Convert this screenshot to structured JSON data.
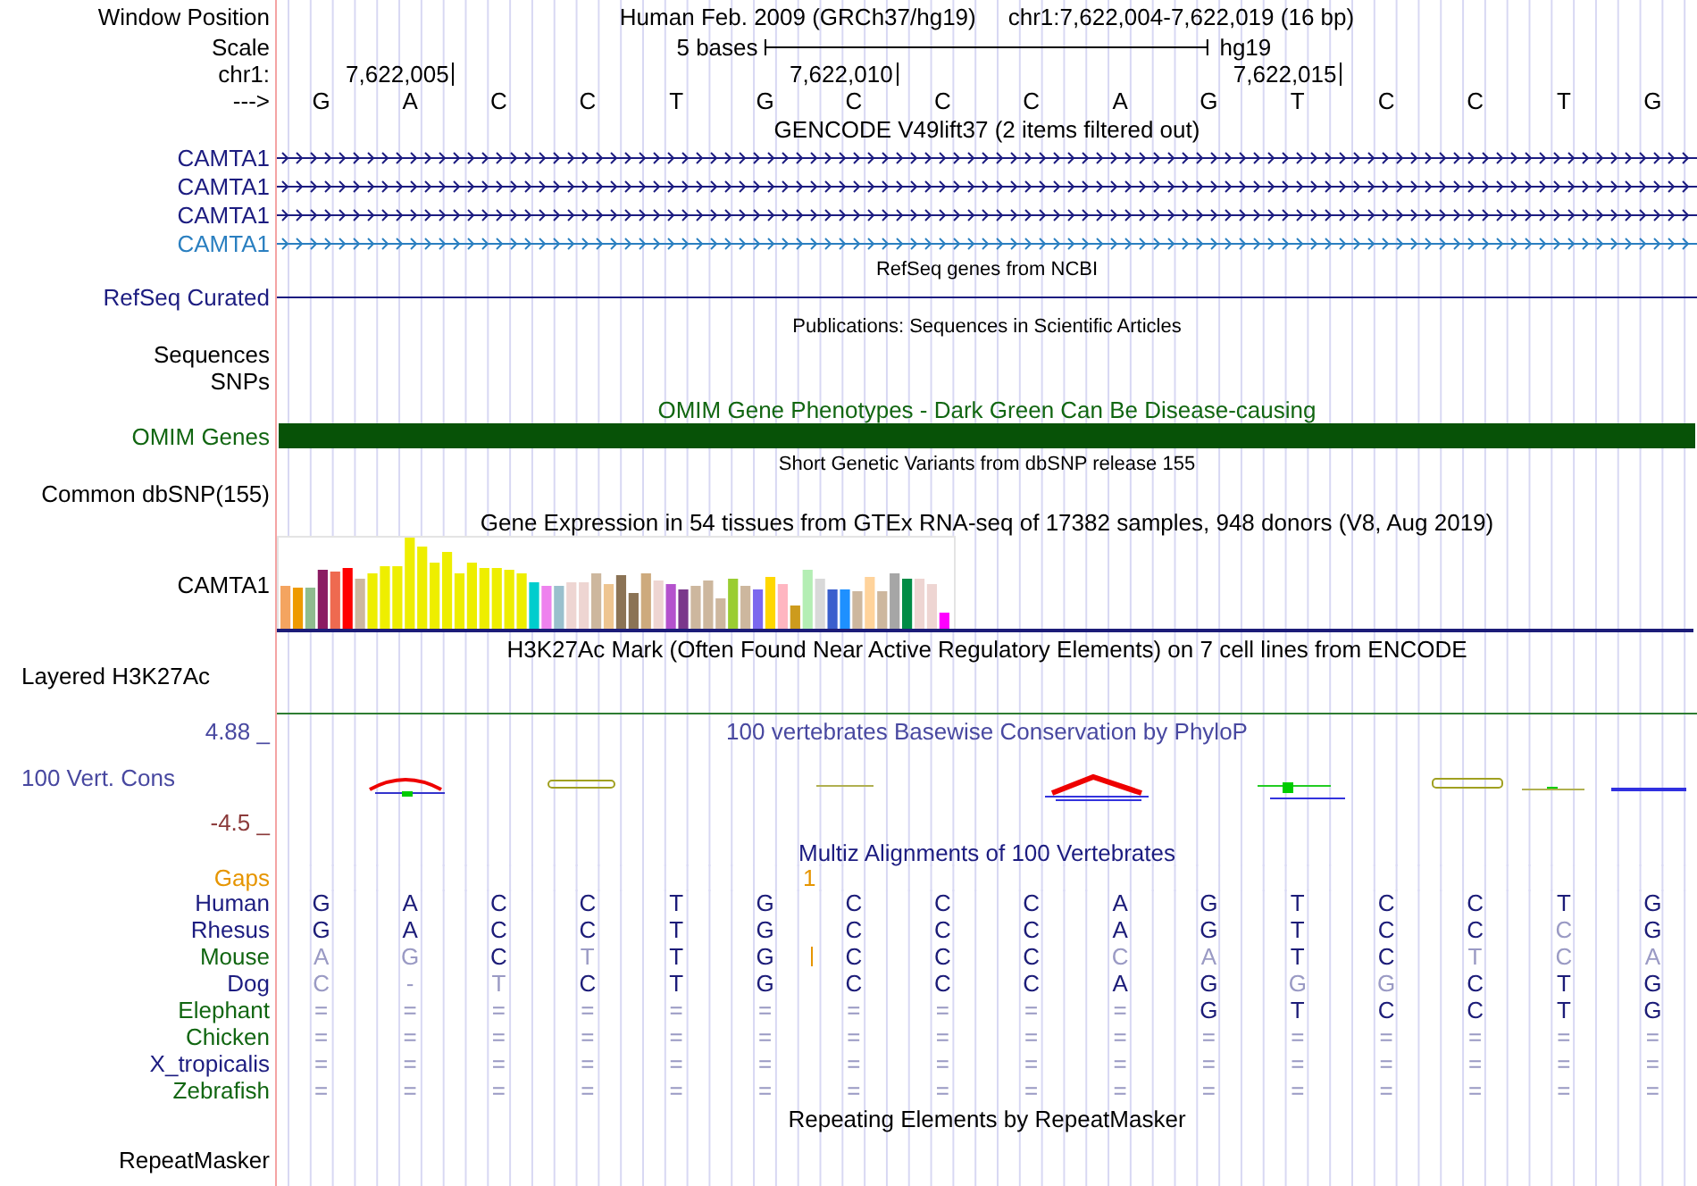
{
  "header": {
    "window_label": "Window Position",
    "assembly": "Human Feb. 2009 (GRCh37/hg19)",
    "position": "chr1:7,622,004-7,622,019 (16 bp)",
    "scale_label": "Scale",
    "scale_text": "5 bases",
    "scale_db": "hg19",
    "chrom_label": "chr1:",
    "ticks": [
      "7,622,005",
      "7,622,010",
      "7,622,015"
    ],
    "strand_label": "--->",
    "bases": [
      "G",
      "A",
      "C",
      "C",
      "T",
      "G",
      "C",
      "C",
      "C",
      "A",
      "G",
      "T",
      "C",
      "C",
      "T",
      "G"
    ]
  },
  "gencode": {
    "title": "GENCODE V49lift37 (2 items filtered out)",
    "genes": [
      {
        "label": "CAMTA1",
        "color": "#1c1c80"
      },
      {
        "label": "CAMTA1",
        "color": "#1c1c80"
      },
      {
        "label": "CAMTA1",
        "color": "#1c1c80"
      },
      {
        "label": "CAMTA1",
        "color": "#2a7fc0"
      }
    ]
  },
  "refseq": {
    "title": "RefSeq genes from NCBI",
    "label": "RefSeq Curated"
  },
  "publications": {
    "title": "Publications: Sequences in Scientific Articles",
    "labels": [
      "Sequences",
      "SNPs"
    ]
  },
  "omim": {
    "title": "OMIM Gene Phenotypes - Dark Green Can Be Disease-causing",
    "label": "OMIM Genes"
  },
  "dbsnp": {
    "title": "Short Genetic Variants from dbSNP release 155",
    "label": "Common dbSNP(155)"
  },
  "gtex": {
    "title": "Gene Expression in 54 tissues from GTEx RNA-seq of 17382 samples, 948 donors (V8, Aug 2019)",
    "label": "CAMTA1"
  },
  "h3k27ac": {
    "title": "H3K27Ac Mark (Often Found Near Active Regulatory Elements) on 7 cell lines from ENCODE",
    "label": "Layered H3K27Ac"
  },
  "conservation": {
    "title": "100 vertebrates Basewise Conservation by PhyloP",
    "label": "100 Vert. Cons",
    "max": "4.88 _",
    "min": "-4.5 _"
  },
  "multiz": {
    "title": "Multiz Alignments of 100 Vertebrates",
    "gaps_label": "Gaps",
    "gaps_count": "1",
    "species": [
      {
        "name": "Human",
        "color": "#1c1c80",
        "bases": [
          "G",
          "A",
          "C",
          "C",
          "T",
          "G",
          "C",
          "C",
          "C",
          "A",
          "G",
          "T",
          "C",
          "C",
          "T",
          "G"
        ],
        "matches": [
          true,
          true,
          true,
          true,
          true,
          true,
          true,
          true,
          true,
          true,
          true,
          true,
          true,
          true,
          true,
          true
        ]
      },
      {
        "name": "Rhesus",
        "color": "#1c1c80",
        "bases": [
          "G",
          "A",
          "C",
          "C",
          "T",
          "G",
          "C",
          "C",
          "C",
          "A",
          "G",
          "T",
          "C",
          "C",
          "C",
          "G"
        ],
        "matches": [
          true,
          true,
          true,
          true,
          true,
          true,
          true,
          true,
          true,
          true,
          true,
          true,
          true,
          true,
          false,
          true
        ]
      },
      {
        "name": "Mouse",
        "color": "#116611",
        "bases": [
          "A",
          "G",
          "C",
          "T",
          "T",
          "G",
          "C",
          "C",
          "C",
          "C",
          "A",
          "T",
          "C",
          "T",
          "C",
          "A"
        ],
        "matches": [
          false,
          false,
          true,
          false,
          true,
          true,
          true,
          true,
          true,
          false,
          false,
          true,
          true,
          false,
          false,
          false
        ],
        "insertions": [
          false,
          false,
          false,
          false,
          false,
          true,
          false,
          false,
          false,
          false,
          false,
          false,
          false,
          false,
          false,
          false
        ]
      },
      {
        "name": "Dog",
        "color": "#1c1c80",
        "bases": [
          "C",
          "-",
          "T",
          "C",
          "T",
          "G",
          "C",
          "C",
          "C",
          "A",
          "G",
          "G",
          "G",
          "C",
          "T",
          "G"
        ],
        "matches": [
          false,
          false,
          false,
          true,
          true,
          true,
          true,
          true,
          true,
          true,
          true,
          false,
          false,
          true,
          true,
          true
        ]
      },
      {
        "name": "Elephant",
        "color": "#116611",
        "bases": [
          "=",
          "=",
          "=",
          "=",
          "=",
          "=",
          "=",
          "=",
          "=",
          "=",
          "G",
          "T",
          "C",
          "C",
          "T",
          "G"
        ],
        "matches": [
          false,
          false,
          false,
          false,
          false,
          false,
          false,
          false,
          false,
          false,
          true,
          true,
          true,
          true,
          true,
          true
        ]
      },
      {
        "name": "Chicken",
        "color": "#116611",
        "bases": [
          "=",
          "=",
          "=",
          "=",
          "=",
          "=",
          "=",
          "=",
          "=",
          "=",
          "=",
          "=",
          "=",
          "=",
          "=",
          "="
        ],
        "matches": [
          false,
          false,
          false,
          false,
          false,
          false,
          false,
          false,
          false,
          false,
          false,
          false,
          false,
          false,
          false,
          false
        ]
      },
      {
        "name": "X_tropicalis",
        "color": "#1c1c80",
        "bases": [
          "=",
          "=",
          "=",
          "=",
          "=",
          "=",
          "=",
          "=",
          "=",
          "=",
          "=",
          "=",
          "=",
          "=",
          "=",
          "="
        ],
        "matches": [
          false,
          false,
          false,
          false,
          false,
          false,
          false,
          false,
          false,
          false,
          false,
          false,
          false,
          false,
          false,
          false
        ]
      },
      {
        "name": "Zebrafish",
        "color": "#116611",
        "bases": [
          "=",
          "=",
          "=",
          "=",
          "=",
          "=",
          "=",
          "=",
          "=",
          "=",
          "=",
          "=",
          "=",
          "=",
          "=",
          "="
        ],
        "matches": [
          false,
          false,
          false,
          false,
          false,
          false,
          false,
          false,
          false,
          false,
          false,
          false,
          false,
          false,
          false,
          false
        ]
      }
    ]
  },
  "repeatmasker": {
    "title": "Repeating Elements by RepeatMasker",
    "label": "RepeatMasker"
  }
}
